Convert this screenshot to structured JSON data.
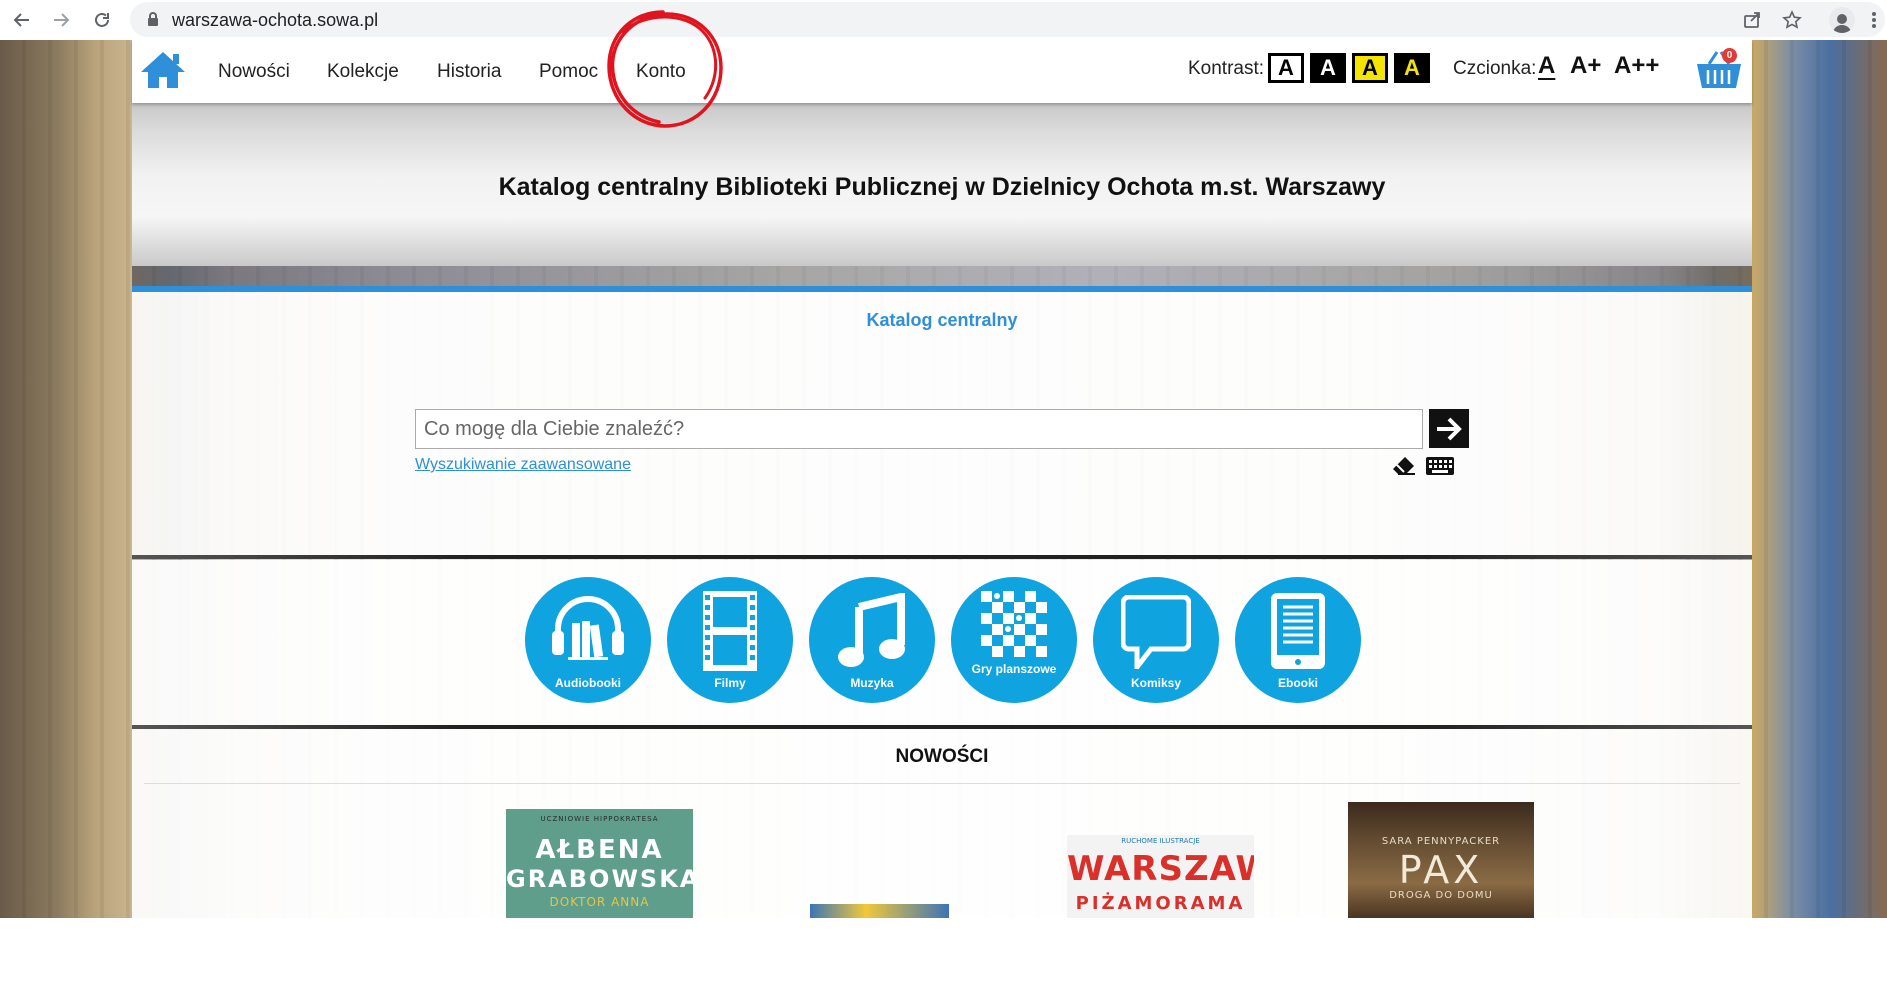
{
  "browser": {
    "url": "warszawa-ochota.sowa.pl",
    "icons": [
      "back-arrow-icon",
      "forward-arrow-icon",
      "reload-icon",
      "lock-icon",
      "share-icon",
      "star-icon",
      "profile-icon",
      "kebab-menu-icon"
    ]
  },
  "nav": {
    "menu": [
      "Nowości",
      "Kolekcje",
      "Historia",
      "Pomoc",
      "Konto"
    ],
    "contrast_label": "Kontrast:",
    "contrast_options": [
      "A",
      "A",
      "A",
      "A"
    ],
    "font_label": "Czcionka:",
    "font_sizes": [
      "A",
      "A+",
      "A++"
    ],
    "basket_count": "0"
  },
  "hero": {
    "title": "Katalog centralny Biblioteki Publicznej w Dzielnicy Ochota m.st. Warszawy"
  },
  "search": {
    "catalog_title": "Katalog centralny",
    "placeholder": "Co mogę dla Ciebie znaleźć?",
    "advanced_link": "Wyszukiwanie zaawansowane"
  },
  "categories": [
    {
      "label": "Audiobooki",
      "icon": "headphones-books-icon"
    },
    {
      "label": "Filmy",
      "icon": "film-strip-icon"
    },
    {
      "label": "Muzyka",
      "icon": "music-note-icon"
    },
    {
      "label": "Gry planszowe",
      "icon": "board-game-icon"
    },
    {
      "label": "Komiksy",
      "icon": "speech-bubble-icon"
    },
    {
      "label": "Ebooki",
      "icon": "ebook-reader-icon"
    }
  ],
  "news": {
    "title": "NOWOŚCI",
    "books": [
      {
        "lines": [
          "UCZNIOWIE HIPPOKRATESA",
          "AŁBENA",
          "GRABOWSKA",
          "DOKTOR ANNA"
        ]
      },
      {
        "lines": []
      },
      {
        "lines": [
          "RUCHOME ILUSTRACJE",
          "WARSZAWA",
          "PIŻAMORAMA"
        ]
      },
      {
        "lines": [
          "SARA PENNYPACKER",
          "PAX",
          "DROGA DO DOMU"
        ]
      }
    ]
  },
  "colors": {
    "accent_blue": "#2f8fd8",
    "category_blue": "#0fa3e0",
    "annotation_red": "#e0141e",
    "contrast_yellow": "#f5e400"
  }
}
